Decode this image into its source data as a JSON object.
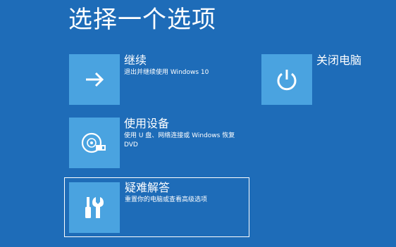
{
  "page_title": "选择一个选项",
  "options": [
    {
      "title": "继续",
      "description": "退出并继续使用 Windows 10",
      "icon": "arrow-right-icon"
    },
    {
      "title": "使用设备",
      "description": "使用 U 盘、网络连接或 Windows 恢复 DVD",
      "icon": "disc-drive-icon"
    },
    {
      "title": "疑难解答",
      "description": "重置你的电脑或查看高级选项",
      "icon": "tools-icon"
    },
    {
      "title": "关闭电脑",
      "description": "",
      "icon": "power-icon"
    }
  ],
  "colors": {
    "background": "#1e6cb8",
    "tile": "#4aa3e0",
    "text": "#ffffff"
  }
}
